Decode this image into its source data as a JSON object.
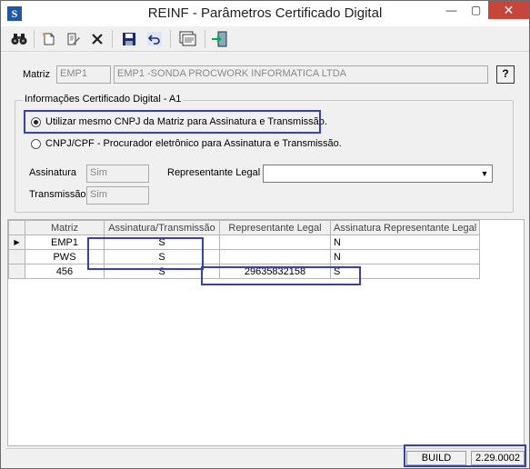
{
  "window": {
    "title": "REINF - Parâmetros Certificado Digital"
  },
  "title_bar": {
    "minimize": "—",
    "maximize": "▢",
    "close": "✕"
  },
  "toolbar": [
    "binoculars-icon",
    "new-icon",
    "edit-icon",
    "delete-icon",
    "save-icon",
    "undo-icon",
    "report-icon",
    "exit-icon"
  ],
  "matriz": {
    "label": "Matriz",
    "code": "EMP1",
    "name": "EMP1 -SONDA PROCWORK INFORMATICA LTDA",
    "help": "?"
  },
  "cert": {
    "group_title": "Informações Certificado Digital - A1",
    "option1": "Utilizar mesmo CNPJ da Matriz para Assinatura e Transmissão.",
    "option2": "CNPJ/CPF - Procurador eletrônico para Assinatura e Transmissão.",
    "selected": "option1",
    "assinatura_label": "Assinatura",
    "assinatura_value": "Sim",
    "transmissao_label": "Transmissão",
    "transmissao_value": "Sim",
    "representante_label": "Representante Legal",
    "representante_value": ""
  },
  "grid": {
    "headers": [
      "Matriz",
      "Assinatura/Transmissão",
      "Representante Legal",
      "Assinatura Representante Legal"
    ],
    "rows": [
      [
        "EMP1",
        "S",
        "",
        "N"
      ],
      [
        "PWS",
        "S",
        "",
        "N"
      ],
      [
        "456",
        "S",
        "29635832158",
        "S"
      ]
    ]
  },
  "status": {
    "build_label": "BUILD",
    "build_version": "2.29.0002"
  }
}
